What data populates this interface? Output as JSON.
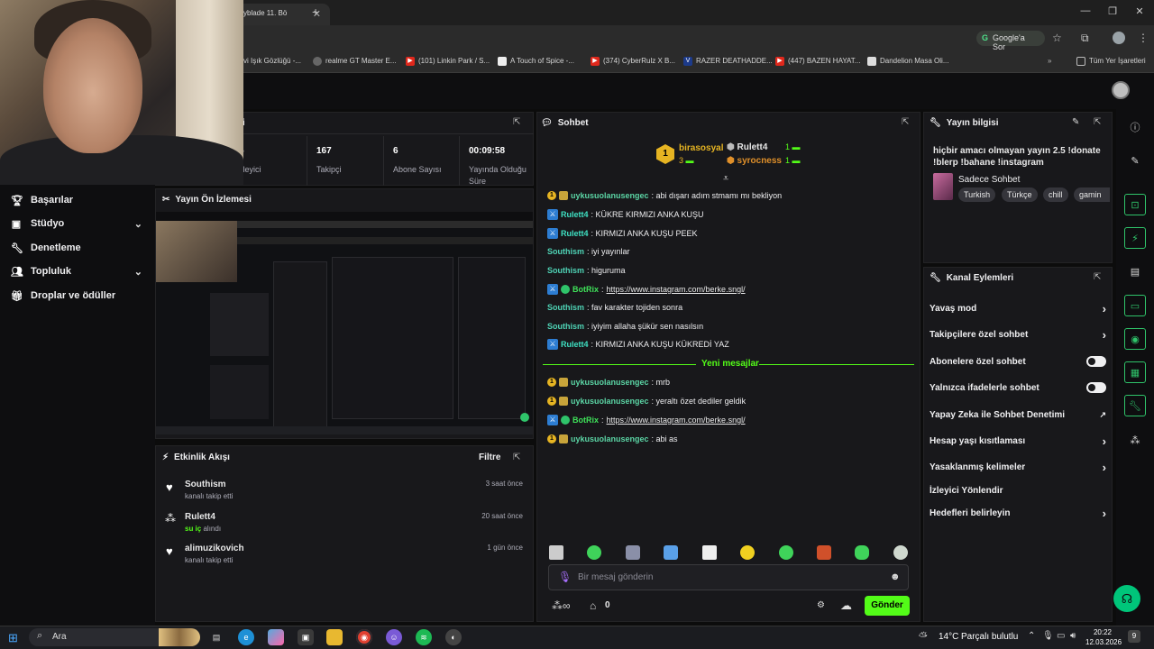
{
  "browser": {
    "active_tab_title": "yblade 11. Bö",
    "google_button": "Google'a Sor",
    "bookmarks": [
      {
        "label": "vi Işık Gözlüğü -..."
      },
      {
        "label": "realme GT Master E..."
      },
      {
        "label": "(101) Linkin Park / S..."
      },
      {
        "label": "A Touch of Spice -..."
      },
      {
        "label": "(374) CyberRulz X B..."
      },
      {
        "label": "RAZER DEATHADDE..."
      },
      {
        "label": "(447) BAZEN HAYAT..."
      },
      {
        "label": "Dandelion Masa Oli..."
      }
    ],
    "all_bookmarks": "Tüm Yer İşaretleri"
  },
  "sidebar": {
    "items": [
      {
        "label": "Başarılar",
        "icon": "trophy-icon"
      },
      {
        "label": "Stüdyo",
        "icon": "studio-icon"
      },
      {
        "label": "Denetleme",
        "icon": "wrench-icon"
      },
      {
        "label": "Topluluk",
        "icon": "community-icon"
      },
      {
        "label": "Droplar ve ödüller",
        "icon": "drops-icon"
      }
    ]
  },
  "stats": {
    "title_fragment": "ri",
    "items": [
      {
        "value": "5",
        "label": "zleyici"
      },
      {
        "value": "167",
        "label": "Takipçi"
      },
      {
        "value": "6",
        "label": "Abone Sayısı"
      },
      {
        "value": "00:09:58",
        "label": "Yayında Olduğu Süre"
      }
    ]
  },
  "preview": {
    "title": "Yayın Ön İzlemesi"
  },
  "activity": {
    "title": "Etkinlik Akışı",
    "filter": "Filtre",
    "events": [
      {
        "user": "Southism",
        "action": "kanalı takip etti",
        "time": "3 saat önce",
        "icon": "heart-icon"
      },
      {
        "user": "Rulett4",
        "action": "su iç",
        "action2": "alındı",
        "time": "20 saat önce",
        "icon": "channel-points-icon"
      },
      {
        "user": "alimuzikovich",
        "action": "kanalı takip etti",
        "time": "1 gün önce",
        "icon": "heart-icon"
      }
    ]
  },
  "chat": {
    "title": "Sohbet",
    "leaderboard": {
      "first_name": "birasosyal",
      "first_score": "3",
      "rank": "1",
      "second_name": "Rulett4",
      "second_score": "1",
      "third_name": "syrocness",
      "third_score": "1"
    },
    "messages": [
      {
        "user": "uykusuolanusengec",
        "text": ": abi dışarı adım stmamı mı bekliyon",
        "badges": "sub"
      },
      {
        "user": "Rulett4",
        "text": ": KÜKRE KIRMIZI ANKA KUŞU",
        "badges": "mod"
      },
      {
        "user": "Rulett4",
        "text": ": KIRMIZI ANKA KUŞU PEEK",
        "badges": "mod"
      },
      {
        "user": "Southism",
        "text": ": iyi yayınlar",
        "badges": ""
      },
      {
        "user": "Southism",
        "text": ": higuruma",
        "badges": ""
      },
      {
        "user": "BotRix",
        "text": ": ",
        "link": "https://www.instagram.com/berke.sngl/",
        "badges": "bot"
      },
      {
        "user": "Southism",
        "text": ": fav karakter tojiden sonra",
        "badges": ""
      },
      {
        "user": "Southism",
        "text": ": iyiyim allaha şükür sen nasılsın",
        "badges": ""
      },
      {
        "user": "Rulett4",
        "text": ": KIRMIZI ANKA KUŞU KÜKREDİ YAZ",
        "badges": "mod"
      }
    ],
    "new_messages_label": "Yeni mesajlar",
    "new_messages": [
      {
        "user": "uykusuolanusengec",
        "text": ": mrb",
        "badges": "sub"
      },
      {
        "user": "uykusuolanusengec",
        "text": ": yeraltı özet dediler geldik",
        "badges": "sub"
      },
      {
        "user": "BotRix",
        "text": ": ",
        "link": "https://www.instagram.com/berke.sngl/",
        "badges": "bot"
      },
      {
        "user": "uykusuolanusengec",
        "text": ": abi as",
        "badges": "sub"
      }
    ],
    "input_placeholder": "Bir mesaj gönderin",
    "points": "0",
    "send": "Gönder"
  },
  "stream_info": {
    "title": "Yayın bilgisi",
    "stream_title": "hiçbir amacı olmayan yayın 2.5 !donate !blerp !bahane !instagram",
    "category": "Sadece Sohbet",
    "tags": [
      "Turkish",
      "Türkçe",
      "chill",
      "gamin"
    ]
  },
  "channel_actions": {
    "title": "Kanal Eylemleri",
    "items": [
      {
        "label": "Yavaş mod",
        "control": "chevron"
      },
      {
        "label": "Takipçilere özel sohbet",
        "control": "chevron"
      },
      {
        "label": "Abonelere özel sohbet",
        "control": "toggle"
      },
      {
        "label": "Yalnızca ifadelerle sohbet",
        "control": "toggle"
      },
      {
        "label": "Yapay Zeka ile Sohbet Denetimi",
        "control": "external"
      },
      {
        "label": "Hesap yaşı kısıtlaması",
        "control": "chevron"
      },
      {
        "label": "Yasaklanmış kelimeler",
        "control": "chevron"
      },
      {
        "label": "İzleyici Yönlendir",
        "control": "none"
      },
      {
        "label": "Hedefleri belirleyin",
        "control": "chevron"
      }
    ]
  },
  "taskbar": {
    "search": "Ara",
    "weather_temp": "14°C",
    "weather_text": "Parçalı bulutlu",
    "time": "20:22",
    "date": "12.03.2026",
    "notif": "9"
  },
  "colors": {
    "accent": "#00f593",
    "brand_green": "#53fc18",
    "panel": "#18181b"
  }
}
